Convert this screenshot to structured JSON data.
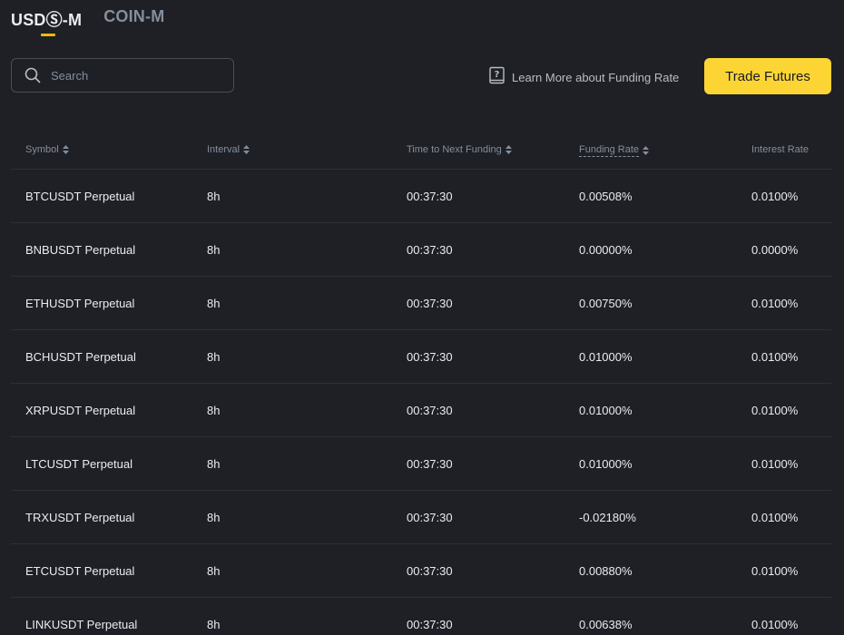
{
  "tabs": [
    {
      "label": "USDⓈ-M",
      "active": true
    },
    {
      "label": "COIN-M",
      "active": false
    }
  ],
  "search": {
    "placeholder": "Search"
  },
  "learn_more": {
    "label": "Learn More about Funding Rate"
  },
  "trade_button": {
    "label": "Trade Futures"
  },
  "colors": {
    "background": "#1e2026",
    "accent": "#fcd535",
    "tab_indicator": "#f0b90b",
    "muted_text": "#848e9c",
    "divider": "#2b3139"
  },
  "table": {
    "headers": {
      "symbol": "Symbol",
      "interval": "Interval",
      "time_to_next": "Time to Next Funding",
      "funding_rate": "Funding Rate",
      "interest_rate": "Interest Rate"
    },
    "rows": [
      {
        "symbol": "BTCUSDT Perpetual",
        "interval": "8h",
        "time": "00:37:30",
        "funding": "0.00508%",
        "interest": "0.0100%"
      },
      {
        "symbol": "BNBUSDT Perpetual",
        "interval": "8h",
        "time": "00:37:30",
        "funding": "0.00000%",
        "interest": "0.0000%"
      },
      {
        "symbol": "ETHUSDT Perpetual",
        "interval": "8h",
        "time": "00:37:30",
        "funding": "0.00750%",
        "interest": "0.0100%"
      },
      {
        "symbol": "BCHUSDT Perpetual",
        "interval": "8h",
        "time": "00:37:30",
        "funding": "0.01000%",
        "interest": "0.0100%"
      },
      {
        "symbol": "XRPUSDT Perpetual",
        "interval": "8h",
        "time": "00:37:30",
        "funding": "0.01000%",
        "interest": "0.0100%"
      },
      {
        "symbol": "LTCUSDT Perpetual",
        "interval": "8h",
        "time": "00:37:30",
        "funding": "0.01000%",
        "interest": "0.0100%"
      },
      {
        "symbol": "TRXUSDT Perpetual",
        "interval": "8h",
        "time": "00:37:30",
        "funding": "-0.02180%",
        "interest": "0.0100%"
      },
      {
        "symbol": "ETCUSDT Perpetual",
        "interval": "8h",
        "time": "00:37:30",
        "funding": "0.00880%",
        "interest": "0.0100%"
      },
      {
        "symbol": "LINKUSDT Perpetual",
        "interval": "8h",
        "time": "00:37:30",
        "funding": "0.00638%",
        "interest": "0.0100%"
      }
    ]
  }
}
